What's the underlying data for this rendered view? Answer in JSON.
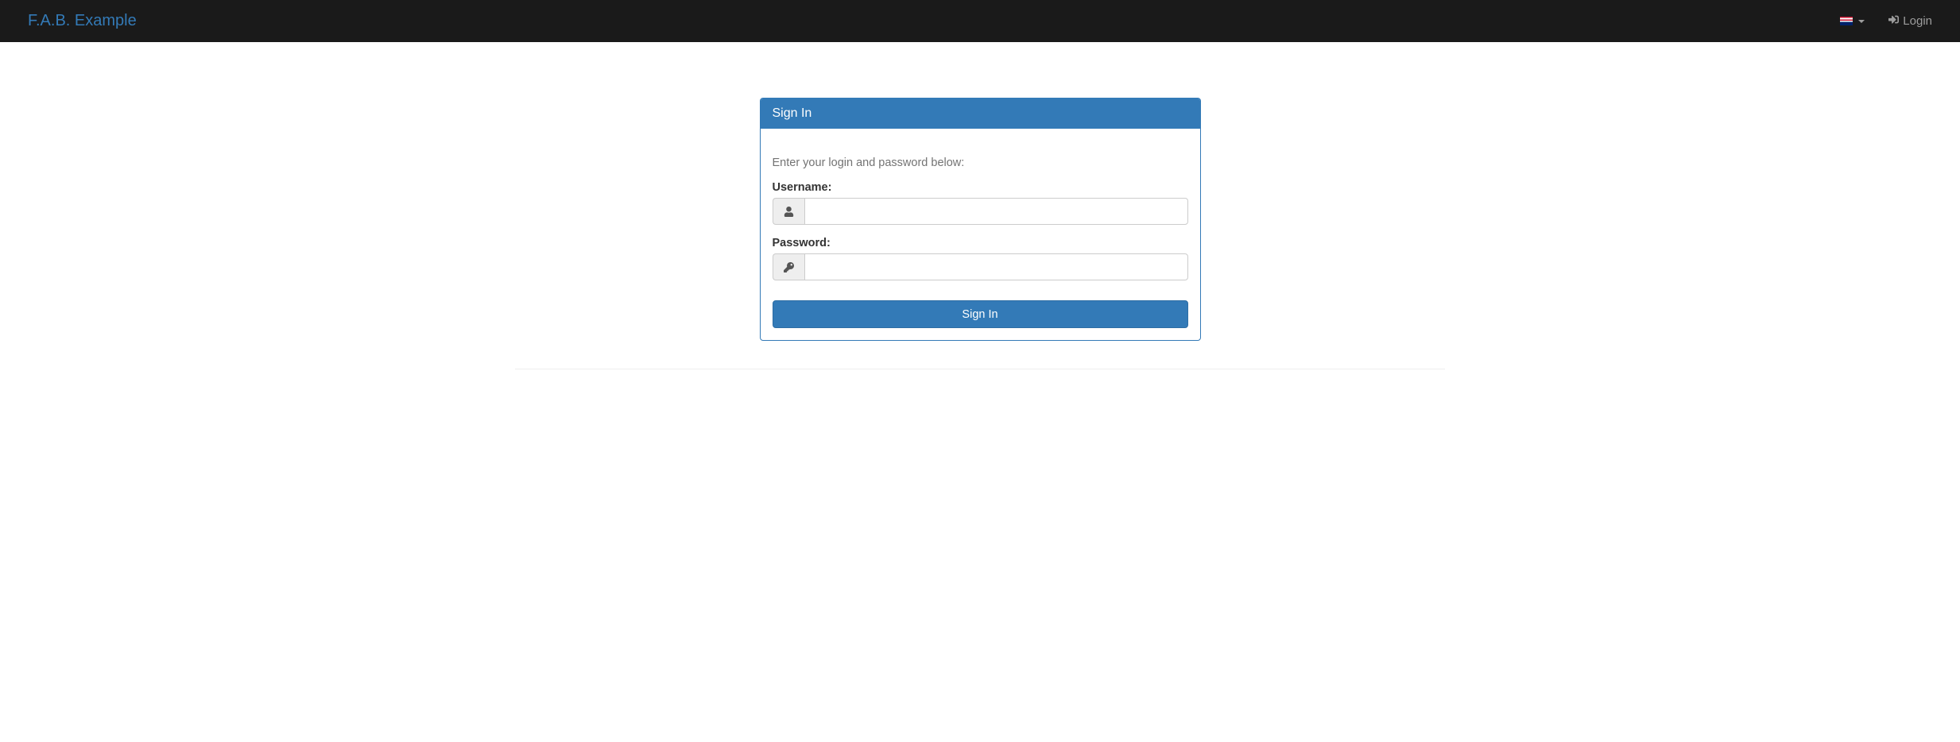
{
  "navbar": {
    "brand": "F.A.B. Example",
    "login_label": "Login"
  },
  "panel": {
    "title": "Sign In",
    "help_text": "Enter your login and password below:",
    "username_label": "Username:",
    "password_label": "Password:",
    "username_value": "",
    "password_value": "",
    "submit_label": "Sign In"
  }
}
